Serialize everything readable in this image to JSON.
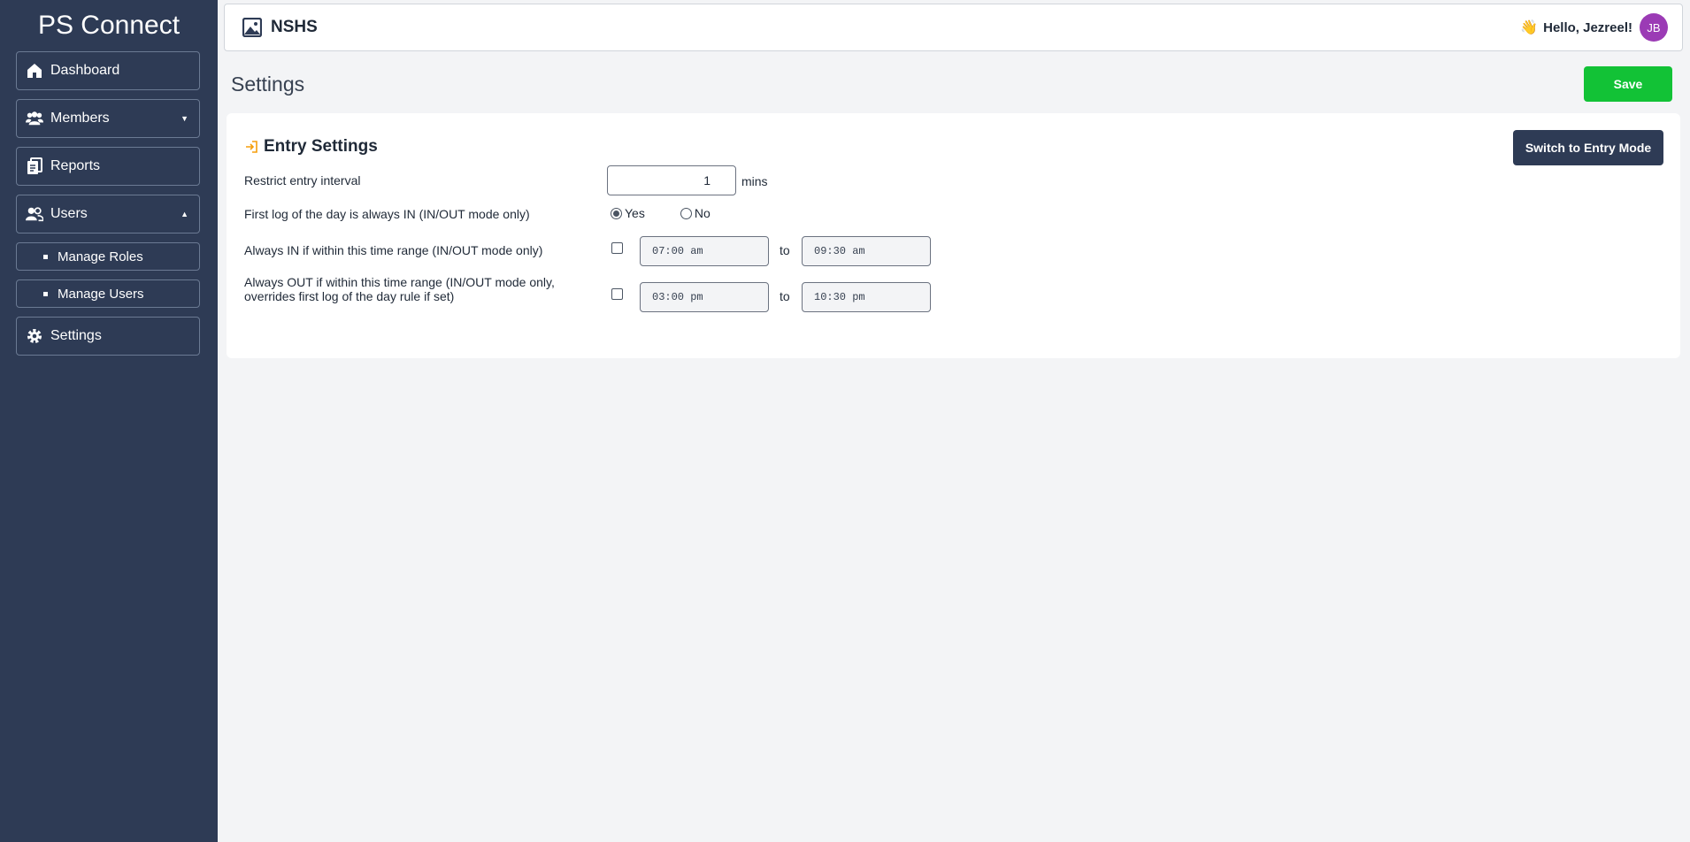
{
  "app": {
    "title": "PS Connect"
  },
  "sidebar": {
    "items": [
      {
        "label": "Dashboard",
        "icon": "home-icon"
      },
      {
        "label": "Members",
        "icon": "members-icon",
        "caret": "▼"
      },
      {
        "label": "Reports",
        "icon": "reports-icon"
      },
      {
        "label": "Users",
        "icon": "users-icon",
        "caret": "▲"
      },
      {
        "label": "Settings",
        "icon": "gear-icon"
      }
    ],
    "subitems": [
      {
        "label": "Manage Roles"
      },
      {
        "label": "Manage Users"
      }
    ]
  },
  "header": {
    "org_name": "NSHS",
    "greeting": "Hello, Jezreel!",
    "avatar_initials": "JB"
  },
  "page": {
    "title": "Settings",
    "save_label": "Save"
  },
  "entry_settings": {
    "title": "Entry Settings",
    "switch_label": "Switch to Entry Mode",
    "restrict": {
      "label": "Restrict entry interval",
      "value": "1",
      "unit": "mins"
    },
    "first_log": {
      "label": "First log of the day is always IN (IN/OUT mode only)",
      "options": [
        "Yes",
        "No"
      ],
      "selected": "Yes"
    },
    "always_in": {
      "label": "Always IN if within this time range (IN/OUT mode only)",
      "checked": false,
      "from": "07:00 am",
      "to_label": "to",
      "to": "09:30 am"
    },
    "always_out": {
      "label_line1": "Always OUT if within this time range (IN/OUT mode only,",
      "label_line2": "overrides first log of the day rule if set)",
      "checked": false,
      "from": "03:00 pm",
      "to_label": "to",
      "to": "10:30 pm"
    }
  },
  "colors": {
    "sidebar_bg": "#2e3b55",
    "save_green": "#12c236",
    "switch_bg": "#2e3b55",
    "avatar_bg": "#9b3bb5",
    "accent_orange": "#f59e0b"
  }
}
